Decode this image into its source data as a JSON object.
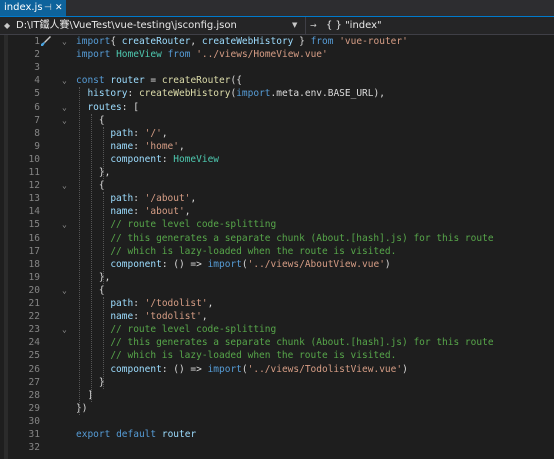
{
  "tab": {
    "name": "index.js",
    "pin_glyph": "⊣",
    "close_glyph": "✕"
  },
  "nav": {
    "path": "D:\\IT鐵人賽\\VueTest\\vue-testing\\jsconfig.json",
    "symbol": "{ } \"index\""
  },
  "code": [
    {
      "n": "1",
      "t": [
        [
          "kw",
          "import"
        ],
        [
          "",
          "{ "
        ],
        [
          "var",
          "createRouter"
        ],
        [
          "",
          ", "
        ],
        [
          "var",
          "createWebHistory"
        ],
        [
          "",
          " } "
        ],
        [
          "kw",
          "from"
        ],
        [
          "",
          " "
        ],
        [
          "str",
          "'vue-router'"
        ]
      ]
    },
    {
      "n": "2",
      "t": [
        [
          "kw",
          "import"
        ],
        [
          "",
          " "
        ],
        [
          "cls",
          "HomeView"
        ],
        [
          "",
          " "
        ],
        [
          "kw",
          "from"
        ],
        [
          "",
          " "
        ],
        [
          "str",
          "'../views/HomeView.vue'"
        ]
      ]
    },
    {
      "n": "3",
      "t": []
    },
    {
      "n": "4",
      "t": [
        [
          "kw",
          "const"
        ],
        [
          "",
          " "
        ],
        [
          "var",
          "router"
        ],
        [
          "",
          " = "
        ],
        [
          "fn",
          "createRouter"
        ],
        [
          "",
          "({"
        ]
      ]
    },
    {
      "n": "5",
      "t": [
        [
          "",
          "  "
        ],
        [
          "var",
          "history"
        ],
        [
          "",
          ": "
        ],
        [
          "fn",
          "createWebHistory"
        ],
        [
          "",
          "("
        ],
        [
          "kw",
          "import"
        ],
        [
          "",
          ".meta.env.BASE_URL),"
        ]
      ]
    },
    {
      "n": "6",
      "t": [
        [
          "",
          "  "
        ],
        [
          "var",
          "routes"
        ],
        [
          "",
          ": ["
        ]
      ]
    },
    {
      "n": "7",
      "t": [
        [
          "",
          "    {"
        ]
      ]
    },
    {
      "n": "8",
      "t": [
        [
          "",
          "      "
        ],
        [
          "var",
          "path"
        ],
        [
          "",
          ": "
        ],
        [
          "str",
          "'/'"
        ],
        [
          "",
          ","
        ]
      ]
    },
    {
      "n": "9",
      "t": [
        [
          "",
          "      "
        ],
        [
          "var",
          "name"
        ],
        [
          "",
          ": "
        ],
        [
          "str",
          "'home'"
        ],
        [
          "",
          ","
        ]
      ]
    },
    {
      "n": "10",
      "t": [
        [
          "",
          "      "
        ],
        [
          "var",
          "component"
        ],
        [
          "",
          ": "
        ],
        [
          "cls",
          "HomeView"
        ]
      ]
    },
    {
      "n": "11",
      "t": [
        [
          "",
          "    },"
        ]
      ]
    },
    {
      "n": "12",
      "t": [
        [
          "",
          "    {"
        ]
      ]
    },
    {
      "n": "13",
      "t": [
        [
          "",
          "      "
        ],
        [
          "var",
          "path"
        ],
        [
          "",
          ": "
        ],
        [
          "str",
          "'/about'"
        ],
        [
          "",
          ","
        ]
      ]
    },
    {
      "n": "14",
      "t": [
        [
          "",
          "      "
        ],
        [
          "var",
          "name"
        ],
        [
          "",
          ": "
        ],
        [
          "str",
          "'about'"
        ],
        [
          "",
          ","
        ]
      ]
    },
    {
      "n": "15",
      "t": [
        [
          "",
          "      "
        ],
        [
          "com",
          "// route level code-splitting"
        ]
      ]
    },
    {
      "n": "16",
      "t": [
        [
          "",
          "      "
        ],
        [
          "com",
          "// this generates a separate chunk (About.[hash].js) for this route"
        ]
      ]
    },
    {
      "n": "17",
      "t": [
        [
          "",
          "      "
        ],
        [
          "com",
          "// which is lazy-loaded when the route is visited."
        ]
      ]
    },
    {
      "n": "18",
      "t": [
        [
          "",
          "      "
        ],
        [
          "var",
          "component"
        ],
        [
          "",
          ": () => "
        ],
        [
          "kw",
          "import"
        ],
        [
          "",
          "("
        ],
        [
          "str",
          "'../views/AboutView.vue'"
        ],
        [
          "",
          ")"
        ]
      ]
    },
    {
      "n": "19",
      "t": [
        [
          "",
          "    },"
        ]
      ]
    },
    {
      "n": "20",
      "t": [
        [
          "",
          "    {"
        ]
      ]
    },
    {
      "n": "21",
      "t": [
        [
          "",
          "      "
        ],
        [
          "var",
          "path"
        ],
        [
          "",
          ": "
        ],
        [
          "str",
          "'/todolist'"
        ],
        [
          "",
          ","
        ]
      ]
    },
    {
      "n": "22",
      "t": [
        [
          "",
          "      "
        ],
        [
          "var",
          "name"
        ],
        [
          "",
          ": "
        ],
        [
          "str",
          "'todolist'"
        ],
        [
          "",
          ","
        ]
      ]
    },
    {
      "n": "23",
      "t": [
        [
          "",
          "      "
        ],
        [
          "com",
          "// route level code-splitting"
        ]
      ]
    },
    {
      "n": "24",
      "t": [
        [
          "",
          "      "
        ],
        [
          "com",
          "// this generates a separate chunk (About.[hash].js) for this route"
        ]
      ]
    },
    {
      "n": "25",
      "t": [
        [
          "",
          "      "
        ],
        [
          "com",
          "// which is lazy-loaded when the route is visited."
        ]
      ]
    },
    {
      "n": "26",
      "t": [
        [
          "",
          "      "
        ],
        [
          "var",
          "component"
        ],
        [
          "",
          ": () => "
        ],
        [
          "kw",
          "import"
        ],
        [
          "",
          "("
        ],
        [
          "str",
          "'../views/TodolistView.vue'"
        ],
        [
          "",
          ")"
        ]
      ]
    },
    {
      "n": "27",
      "t": [
        [
          "",
          "    }"
        ]
      ]
    },
    {
      "n": "28",
      "t": [
        [
          "",
          "  ]"
        ]
      ]
    },
    {
      "n": "29",
      "t": [
        [
          "",
          "})"
        ]
      ]
    },
    {
      "n": "30",
      "t": []
    },
    {
      "n": "31",
      "t": [
        [
          "kw",
          "export"
        ],
        [
          "",
          " "
        ],
        [
          "kw",
          "default"
        ],
        [
          "",
          " "
        ],
        [
          "var",
          "router"
        ]
      ]
    },
    {
      "n": "32",
      "t": []
    }
  ],
  "folds": [
    "1",
    "4",
    "6",
    "7",
    "12",
    "15",
    "20",
    "23"
  ]
}
